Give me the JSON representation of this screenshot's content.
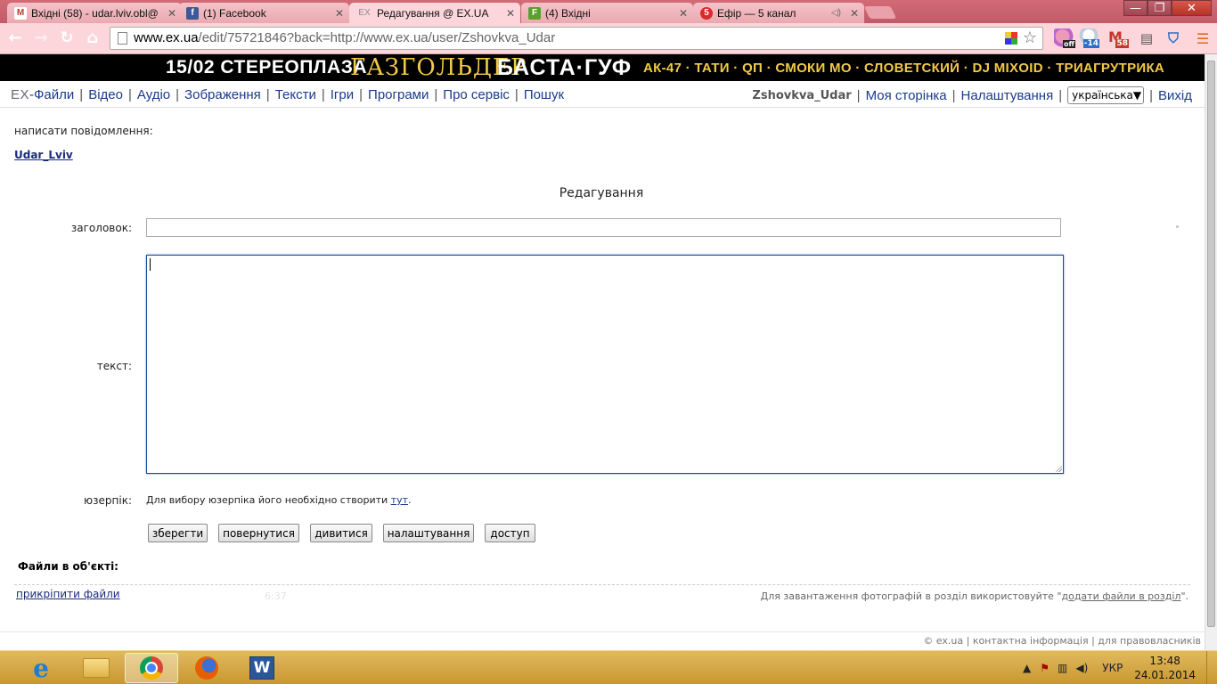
{
  "browser": {
    "tabs": [
      {
        "title": "Вхідні (58) - udar.lviv.obl@",
        "icon": "gmail-icon",
        "color": "#c0392b",
        "glyph": "M"
      },
      {
        "title": "(1) Facebook",
        "icon": "facebook-icon",
        "color": "#3b5998",
        "glyph": "f"
      },
      {
        "title": "Редагування @ EX.UA",
        "icon": "exua-icon",
        "color": "#ffffff",
        "glyph": "EX"
      },
      {
        "title": "(4) Вхідні",
        "icon": "fmail-icon",
        "color": "#5aa12b",
        "glyph": "F"
      },
      {
        "title": "Ефір — 5 канал",
        "icon": "channel5-icon",
        "color": "#d92b2b",
        "glyph": "5"
      }
    ],
    "window_controls": {
      "minimize": "—",
      "maximize": "❐",
      "close": "✕"
    },
    "url_host": "www.ex.ua",
    "url_rest": "/edit/75721846?back=http://www.ex.ua/user/Zshovkva_Udar",
    "nav": {
      "back": "←",
      "forward": "→",
      "reload": "↻",
      "home": "⌂"
    },
    "extensions": [
      {
        "name": "off-extension-icon",
        "badge": "off"
      },
      {
        "name": "weather-extension-icon",
        "badge": "-14"
      },
      {
        "name": "gmail-extension-icon",
        "badge": "58"
      },
      {
        "name": "reader-extension-icon",
        "badge": ""
      },
      {
        "name": "shield-extension-icon",
        "badge": ""
      },
      {
        "name": "menu-icon",
        "badge": ""
      }
    ]
  },
  "banner": {
    "part1": "15/02 СТЕРЕОПЛАЗА",
    "part2": "ГАЗГОЛЬДЕР",
    "part3": "БАСТА·ГУФ",
    "part4": "АК-47 · ТАТИ · QП · СМОКИ МО · СЛОВЕТСКИЙ · DJ MIXOID · ТРИАГРУТРИКА"
  },
  "sitenav": {
    "logo": "EX",
    "items": [
      "-Файли",
      "Відео",
      "Аудіо",
      "Зображення",
      "Тексти",
      "Ігри",
      "Програми",
      "Про сервіс",
      "Пошук"
    ],
    "username": "Zshovkva_Udar",
    "my_page": "Моя сторінка",
    "settings": "Налаштування",
    "language": "українська",
    "logout": "Вихід"
  },
  "page": {
    "write_message": "написати повідомлення:",
    "message_user": "Udar_Lviv",
    "heading": "Редагування",
    "title_label": "заголовок:",
    "title_value": "",
    "text_label": "текст:",
    "text_value": "",
    "userpic_label": "юзерпік:",
    "userpic_text": "Для вибору юзерпіка його необхідно створити ",
    "userpic_link": "тут",
    "userpic_end": ".",
    "buttons": {
      "save": "зберегти",
      "back": "повернутися",
      "view": "дивитися",
      "settings": "налаштування",
      "access": "доступ"
    },
    "files_label": "Файли в об'єкті:",
    "attach_link": "прикріпити файли",
    "ghost_time": "6:37",
    "upload_note": "Для завантаження фотографій в розділ використовуйте \"",
    "upload_link": "додати файли в розділ",
    "upload_note_end": "\"."
  },
  "footer": {
    "copyright": "© ex.ua",
    "contact": "контактна інформація",
    "rights": "для правовласників"
  },
  "taskbar": {
    "language": "УКР",
    "time": "13:48",
    "date": "24.01.2014"
  }
}
